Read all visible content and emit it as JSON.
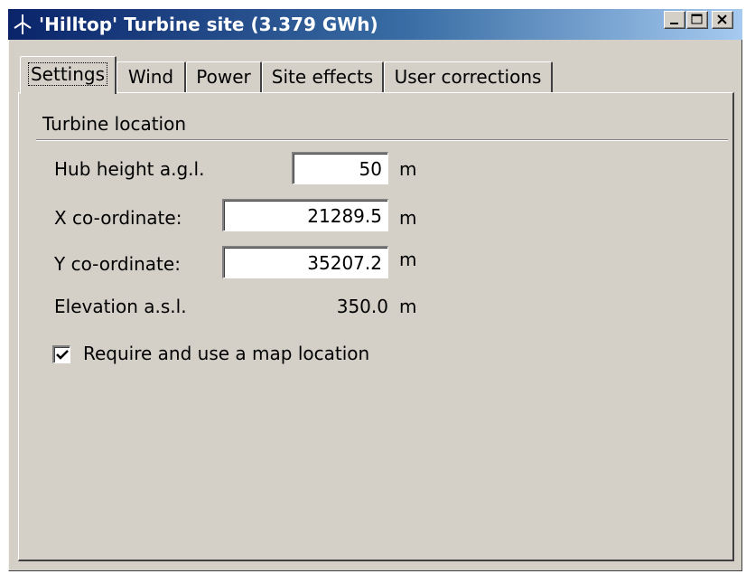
{
  "window": {
    "title": "'Hilltop' Turbine site (3.379 GWh)",
    "icon": "wind-turbine-icon",
    "controls": [
      "minimize-icon",
      "maximize-icon",
      "close-icon"
    ],
    "accent_color": "#0a246a",
    "background_color": "#d4d0c8"
  },
  "tabs": [
    {
      "label": "Settings",
      "active": true
    },
    {
      "label": "Wind",
      "active": false
    },
    {
      "label": "Power",
      "active": false
    },
    {
      "label": "Site effects",
      "active": false
    },
    {
      "label": "User corrections",
      "active": false
    }
  ],
  "settings": {
    "group_title": "Turbine location",
    "hub_height": {
      "label": "Hub height a.g.l.",
      "value": "50",
      "unit": "m"
    },
    "x_coord": {
      "label": "X co-ordinate:",
      "value": "21289.5",
      "unit": "m"
    },
    "y_coord": {
      "label": "Y co-ordinate:",
      "value": "35207.2",
      "unit": "m"
    },
    "elevation": {
      "label": "Elevation a.s.l.",
      "value": "350.0",
      "unit": "m"
    },
    "map_location": {
      "label": "Require and use a map location",
      "checked": true
    }
  }
}
